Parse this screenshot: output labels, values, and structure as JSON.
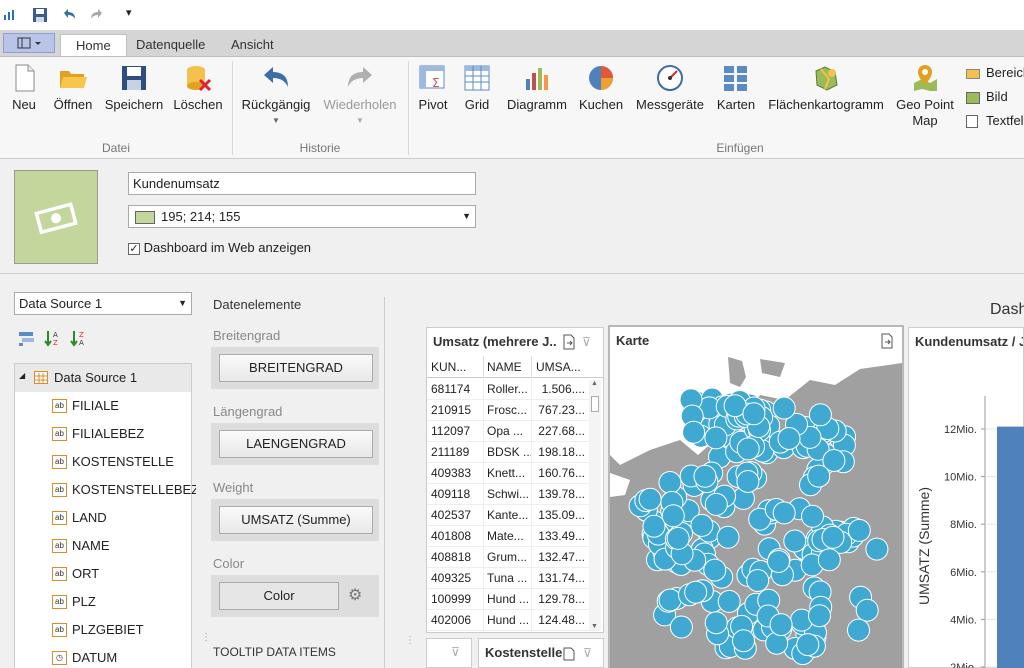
{
  "titlebar": {
    "dropdown_glyph": "▾"
  },
  "tabs": [
    {
      "label": "Home"
    },
    {
      "label": "Datenquelle"
    },
    {
      "label": "Ansicht"
    }
  ],
  "ribbon": {
    "datei": {
      "group": "Datei",
      "neu": "Neu",
      "oeffnen": "Öffnen",
      "speichern": "Speichern",
      "loeschen": "Löschen"
    },
    "historie": {
      "group": "Historie",
      "rueckgaengig": "Rückgängig",
      "wiederholen": "Wiederholen"
    },
    "einfuegen": {
      "group": "Einfügen",
      "pivot": "Pivot",
      "grid": "Grid",
      "diagramm": "Diagramm",
      "kuchen": "Kuchen",
      "messgeraete": "Messgeräte",
      "karten": "Karten",
      "flaechen": "Flächenkartogramm",
      "geo_line1": "Geo Point",
      "geo_line2": "Map",
      "bereich": "Bereich",
      "bild": "Bild",
      "textfeld": "Textfel"
    }
  },
  "header": {
    "title_value": "Kundenumsatz",
    "color_value": "195; 214; 155",
    "color_hex": "#c3d69b",
    "show_web_label": "Dashboard im Web anzeigen",
    "show_web_checked": true
  },
  "datasource": {
    "selected": "Data Source 1",
    "tree_root": "Data Source 1",
    "fields": [
      "FILIALE",
      "FILIALEBEZ",
      "KOSTENSTELLE",
      "KOSTENSTELLEBEZ",
      "LAND",
      "NAME",
      "ORT",
      "PLZ",
      "PLZGEBIET",
      "DATUM"
    ]
  },
  "binding": {
    "title": "Datenelemente",
    "breitengrad_label": "Breitengrad",
    "breitengrad_value": "BREITENGRAD",
    "laengengrad_label": "Längengrad",
    "laengengrad_value": "LAENGENGRAD",
    "weight_label": "Weight",
    "weight_value": "UMSATZ (Summe)",
    "color_label": "Color",
    "color_value": "Color",
    "tooltip_label": "TOOLTIP DATA ITEMS"
  },
  "dashboard": {
    "title_partial": "Dash",
    "grid": {
      "title": "Umsatz (mehrere J...",
      "columns": [
        "KUN...",
        "NAME",
        "UMSA..."
      ],
      "rows": [
        [
          "681174",
          "Roller...",
          "1.506...."
        ],
        [
          "210915",
          "Frosc...",
          "767.23..."
        ],
        [
          "112097",
          "Opa ...",
          "227.68..."
        ],
        [
          "211189",
          "BDSK ...",
          "198.18..."
        ],
        [
          "409383",
          "Knett...",
          "160.76..."
        ],
        [
          "409118",
          "Schwi...",
          "139.78..."
        ],
        [
          "402537",
          "Kante...",
          "135.09..."
        ],
        [
          "401808",
          "Mate...",
          "133.49..."
        ],
        [
          "408818",
          "Grum...",
          "132.47..."
        ],
        [
          "409325",
          "Tuna ...",
          "131.74..."
        ],
        [
          "100999",
          "Hund ...",
          "129.78..."
        ],
        [
          "402006",
          "Hund ...",
          "124.48..."
        ]
      ]
    },
    "map": {
      "title": "Karte"
    },
    "bottom_widget": {
      "title": "Kostenstelle"
    },
    "chart": {
      "title": "Kundenumsatz / J",
      "ylabel": "UMSATZ (Summe)"
    }
  },
  "chart_data": {
    "type": "bar",
    "ylabel": "UMSATZ (Summe)",
    "ticks": [
      "12Mio.",
      "10Mio.",
      "8Mio.",
      "6Mio.",
      "4Mio.",
      "2Mio."
    ],
    "tick_values": [
      12,
      10,
      8,
      6,
      4,
      2
    ],
    "series": [
      {
        "values": [
          12.1
        ]
      }
    ],
    "bar_color": "#4f81bd"
  },
  "colors": {
    "accent": "#2b579a",
    "map_point": "#3fa9d1",
    "map_land": "#a0a0a0"
  }
}
